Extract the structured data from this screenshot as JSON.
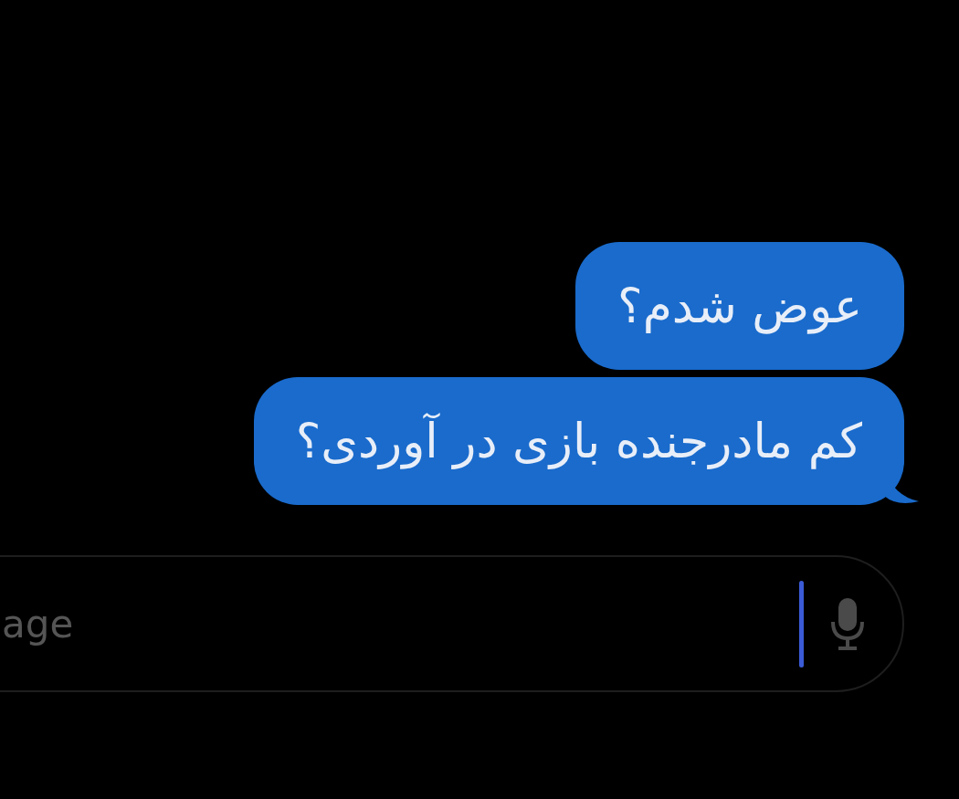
{
  "messages": [
    {
      "text": "عوض شدم؟",
      "tail": false
    },
    {
      "text": "کم مادرجنده بازی در آوردی؟",
      "tail": true
    }
  ],
  "composer": {
    "placeholder": "age"
  }
}
